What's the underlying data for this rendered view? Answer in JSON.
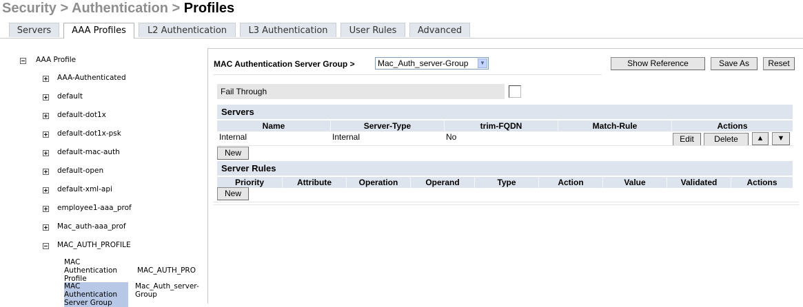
{
  "breadcrumb": {
    "part1": "Security",
    "sep1": " > ",
    "part2": "Authentication",
    "sep2": " > ",
    "current": "Profiles"
  },
  "tabs": [
    {
      "label": "Servers",
      "active": false
    },
    {
      "label": "AAA Profiles",
      "active": true
    },
    {
      "label": "L2 Authentication",
      "active": false
    },
    {
      "label": "L3 Authentication",
      "active": false
    },
    {
      "label": "User Rules",
      "active": false
    },
    {
      "label": "Advanced",
      "active": false
    }
  ],
  "tree": {
    "root": "AAA Profile",
    "items": [
      "AAA-Authenticated",
      "default",
      "default-dot1x",
      "default-dot1x-psk",
      "default-mac-auth",
      "default-open",
      "default-xml-api",
      "employee1-aaa_prof",
      "Mac_auth-aaa_prof",
      "MAC_AUTH_PROFILE"
    ],
    "children": [
      {
        "label": "MAC Authentication Profile",
        "value": "MAC_AUTH_PRO",
        "selected": false
      },
      {
        "label": "MAC Authentication Server Group",
        "value": "Mac_Auth_server-Group",
        "selected": true
      }
    ]
  },
  "panel": {
    "title": "MAC Authentication Server Group >",
    "selected_group": "Mac_Auth_server-Group",
    "buttons": {
      "show_reference": "Show Reference",
      "save_as": "Save As",
      "reset": "Reset"
    },
    "fail_through": {
      "label": "Fail Through",
      "checked": false
    },
    "servers": {
      "title": "Servers",
      "columns": [
        "Name",
        "Server-Type",
        "trim-FQDN",
        "Match-Rule",
        "Actions"
      ],
      "rows": [
        {
          "name": "Internal",
          "server_type": "Internal",
          "trim_fqdn": "No",
          "match_rule": ""
        }
      ],
      "edit": "Edit",
      "delete": "Delete",
      "up": "▲",
      "down": "▼",
      "new": "New"
    },
    "server_rules": {
      "title": "Server Rules",
      "columns": [
        "Priority",
        "Attribute",
        "Operation",
        "Operand",
        "Type",
        "Action",
        "Value",
        "Validated",
        "Actions"
      ],
      "new": "New"
    }
  }
}
